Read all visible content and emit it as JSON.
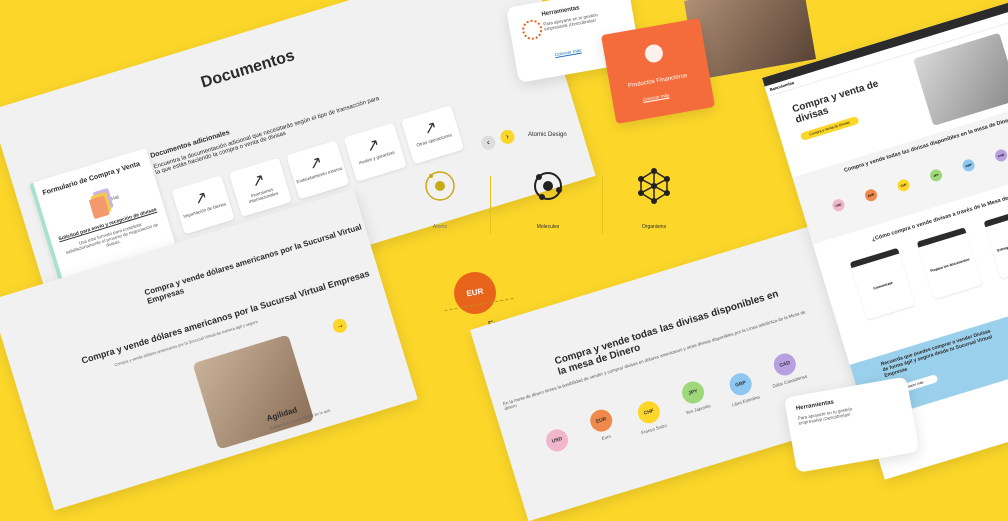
{
  "docs": {
    "title": "Documentos",
    "subtitle": "Documentos adicionales",
    "description": "Encuentra la documentación adicional que necesitarás según el tipo de transacción para la que estás haciendo la compra o venta de divisas",
    "tiles": [
      "Importación de bienes",
      "Inversiones internacionales",
      "Endeudamiento externo",
      "Avales y garantías",
      "Otras operaciones"
    ],
    "form_title": "Formulario de Compra y Venta",
    "form_link": "Solicitud para envío y recepción de divisas",
    "form_text": "Usa este formato para completar satisfactoriamente el proceso de negociación de divisas.",
    "hat_text": "Hat"
  },
  "compra": {
    "header": "Compra y vende dólares americanos por la Sucursal Virtual Empresas",
    "heading": "Compra y vende dólares americanos por la Sucursal Virtual Empresas",
    "paragraph": "Compra y vende dólares americanos por la Sucursal Virtual de manera ágil y segura",
    "feature": "Agilidad",
    "feature_text": "Realiza tus transacciones en lo que"
  },
  "atomic": {
    "title": "Atomic Design",
    "items": [
      "Atoms",
      "Molecules",
      "Organisms"
    ]
  },
  "currency_card": {
    "code": "EUR",
    "label": "Euro"
  },
  "divisas": {
    "heading": "Compra y vende todas las divisas disponibles en la mesa de Dinero",
    "paragraph": "En la mesa de dinero tienes la posibilidad de vender y comprar divisas en dólares americanos y otras divisas disponibles por la Línea telefónica de la Mesa de dinero",
    "currencies": [
      {
        "code": "USD",
        "name": "",
        "color": "#f2b6cc"
      },
      {
        "code": "EUR",
        "name": "Euro",
        "color": "#f08a4c"
      },
      {
        "code": "CHF",
        "name": "Franco Suizo",
        "color": "#fcd72a"
      },
      {
        "code": "JPY",
        "name": "Yen Japonés",
        "color": "#9fd77b"
      },
      {
        "code": "GBP",
        "name": "Libra Esterlina",
        "color": "#8ec7f2"
      },
      {
        "code": "CAD",
        "name": "Dólar Canadiense",
        "color": "#b8a0e0"
      }
    ]
  },
  "herramientas": {
    "title": "Herramientas",
    "text": "Para apoyarte en tu gestión empresarial ¡Descúbrelas!",
    "link": "Conocer más"
  },
  "herramientas2": {
    "title": "Herramientas",
    "text": "Para apoyarte en tu gestión empresarial ¡Descúbrelas!"
  },
  "productos": {
    "title": "Productos Financieros",
    "link": "Conocer más"
  },
  "right": {
    "brand": "Bancolombia",
    "hero_title": "Compra y venta de divisas",
    "hero_button": "Compra y Venta de Divisas",
    "section1": "Compra y vende todas las divisas disponibles en la mesa de Dinero",
    "section2": "¿Cómo compra o vende divisas a través de la Mesa de dinero?",
    "steps": [
      "Comunícate",
      "Prepara los documentos",
      "Entrega los documentos"
    ],
    "blue_title": "Recuerda que puedes comprar o vender Divisas de forma ágil y segura desde tu Sucursal Virtual Empresas",
    "blue_button": "Conocer más",
    "coins": [
      {
        "code": "USD",
        "color": "#f2b6cc"
      },
      {
        "code": "EUR",
        "color": "#f08a4c"
      },
      {
        "code": "CHF",
        "color": "#fcd72a"
      },
      {
        "code": "JPY",
        "color": "#9fd77b"
      },
      {
        "code": "GBP",
        "color": "#8ec7f2"
      },
      {
        "code": "CAD",
        "color": "#b8a0e0"
      }
    ]
  }
}
